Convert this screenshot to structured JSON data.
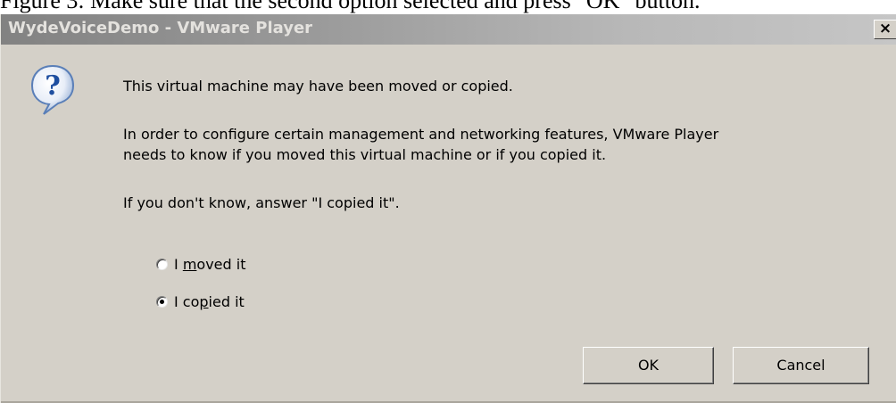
{
  "caption": "Figure 3: Make sure that the second option selected and press \"OK\" button.",
  "dialog": {
    "title": "WydeVoiceDemo - VMware Player",
    "close_label": "×",
    "icon": "question-icon",
    "message": {
      "line1": "This virtual machine may have been moved or copied.",
      "line2a": "In order to configure certain management and networking features, VMware Player",
      "line2b": "needs to know if you moved this virtual machine or if you copied it.",
      "line3": "If you don't know, answer \"I copied it\"."
    },
    "options": [
      {
        "pre": "I ",
        "mnemonic": "m",
        "post": "oved it",
        "selected": false
      },
      {
        "pre": "I co",
        "mnemonic": "p",
        "post": "ied it",
        "selected": true
      }
    ],
    "buttons": {
      "ok": "OK",
      "cancel": "Cancel"
    }
  },
  "colors": {
    "dialog_bg": "#d4d0c8",
    "titlebar_inactive": "#808080",
    "icon_blue": "#2a6ab8"
  }
}
